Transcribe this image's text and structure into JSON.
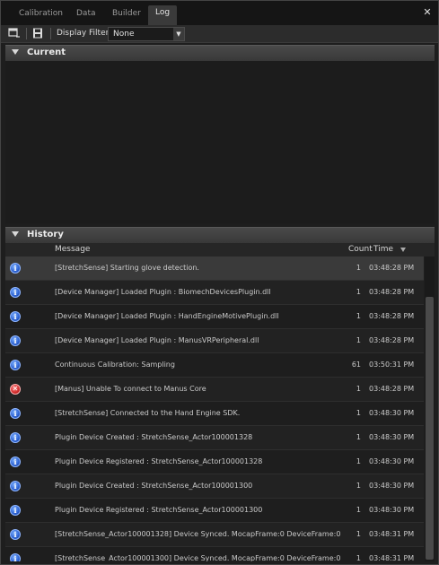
{
  "tabs": [
    {
      "label": "Calibration",
      "active": false
    },
    {
      "label": "Data",
      "active": false
    },
    {
      "label": "Builder",
      "active": false
    },
    {
      "label": "Log",
      "active": true
    }
  ],
  "close_glyph": "✕",
  "toolbar": {
    "filter_label": "Display Filter :",
    "filter_value": "None",
    "icons": [
      "clear-log-icon",
      "save-log-icon"
    ]
  },
  "sections": {
    "current": "Current",
    "history": "History"
  },
  "history": {
    "columns": {
      "message": "Message",
      "count": "Count",
      "time": "Time"
    },
    "rows": [
      {
        "icon": "info",
        "message": "[StretchSense] Starting glove detection.",
        "count": "1",
        "time": "03:48:28 PM",
        "selected": true
      },
      {
        "icon": "info",
        "message": "[Device Manager] Loaded Plugin : BiomechDevicesPlugin.dll",
        "count": "1",
        "time": "03:48:28 PM"
      },
      {
        "icon": "info",
        "message": "[Device Manager] Loaded Plugin : HandEngineMotivePlugin.dll",
        "count": "1",
        "time": "03:48:28 PM"
      },
      {
        "icon": "info",
        "message": "[Device Manager] Loaded Plugin : ManusVRPeripheral.dll",
        "count": "1",
        "time": "03:48:28 PM"
      },
      {
        "icon": "info",
        "message": "Continuous Calibration: Sampling",
        "count": "61",
        "time": "03:50:31 PM"
      },
      {
        "icon": "error",
        "message": "[Manus] Unable To connect to Manus Core",
        "count": "1",
        "time": "03:48:28 PM"
      },
      {
        "icon": "info",
        "message": "[StretchSense] Connected to the Hand Engine SDK.",
        "count": "1",
        "time": "03:48:30 PM"
      },
      {
        "icon": "info",
        "message": "Plugin Device Created : StretchSense_Actor100001328",
        "count": "1",
        "time": "03:48:30 PM"
      },
      {
        "icon": "info",
        "message": "Plugin Device Registered : StretchSense_Actor100001328",
        "count": "1",
        "time": "03:48:30 PM"
      },
      {
        "icon": "info",
        "message": "Plugin Device Created : StretchSense_Actor100001300",
        "count": "1",
        "time": "03:48:30 PM"
      },
      {
        "icon": "info",
        "message": "Plugin Device Registered : StretchSense_Actor100001300",
        "count": "1",
        "time": "03:48:30 PM"
      },
      {
        "icon": "info",
        "message": "[StretchSense_Actor100001328] Device Synced.  MocapFrame:0  DeviceFrame:0",
        "count": "1",
        "time": "03:48:31 PM"
      },
      {
        "icon": "info",
        "message": "[StretchSense_Actor100001300] Device Synced.  MocapFrame:0  DeviceFrame:0",
        "count": "1",
        "time": "03:48:31 PM"
      }
    ]
  }
}
